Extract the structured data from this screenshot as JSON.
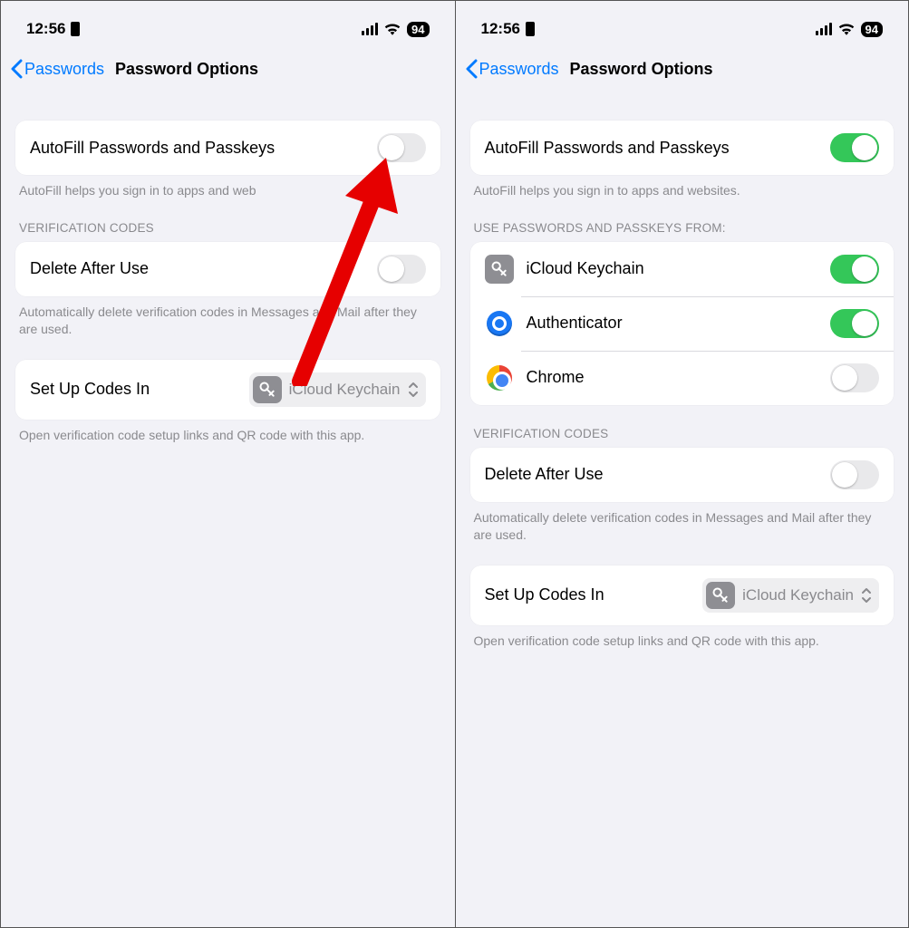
{
  "status": {
    "time": "12:56",
    "battery": "94"
  },
  "nav": {
    "back": "Passwords",
    "title": "Password Options"
  },
  "left": {
    "autofill": {
      "label": "AutoFill Passwords and Passkeys",
      "footer": "AutoFill helps you sign in to apps and web"
    },
    "codes": {
      "header": "VERIFICATION CODES",
      "delete_label": "Delete After Use",
      "delete_footer": "Automatically delete verification codes in Messages and Mail after they are used."
    },
    "setup": {
      "label": "Set Up Codes In",
      "value": "iCloud Keychain",
      "footer": "Open verification code setup links and QR code with this app."
    }
  },
  "right": {
    "autofill": {
      "label": "AutoFill Passwords and Passkeys",
      "footer": "AutoFill helps you sign in to apps and websites."
    },
    "sources": {
      "header": "USE PASSWORDS AND PASSKEYS FROM:",
      "items": [
        {
          "name": "iCloud Keychain",
          "on": true
        },
        {
          "name": "Authenticator",
          "on": true
        },
        {
          "name": "Chrome",
          "on": false
        }
      ]
    },
    "codes": {
      "header": "VERIFICATION CODES",
      "delete_label": "Delete After Use",
      "delete_footer": "Automatically delete verification codes in Messages and Mail after they are used."
    },
    "setup": {
      "label": "Set Up Codes In",
      "value": "iCloud Keychain",
      "footer": "Open verification code setup links and QR code with this app."
    }
  }
}
